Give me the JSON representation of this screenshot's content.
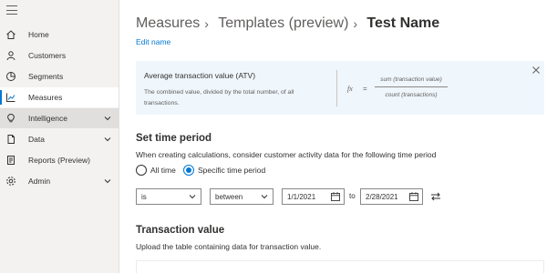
{
  "sidebar": {
    "items": [
      {
        "label": "Home",
        "icon": "home-icon"
      },
      {
        "label": "Customers",
        "icon": "people-icon"
      },
      {
        "label": "Segments",
        "icon": "pie-icon"
      },
      {
        "label": "Measures",
        "icon": "chart-icon",
        "active": true
      },
      {
        "label": "Intelligence",
        "icon": "lightbulb-icon",
        "expandable": true
      },
      {
        "label": "Data",
        "icon": "database-icon",
        "expandable": true
      },
      {
        "label": "Reports (Preview)",
        "icon": "report-icon"
      },
      {
        "label": "Admin",
        "icon": "gear-icon",
        "expandable": true
      }
    ]
  },
  "breadcrumb": {
    "part1": "Measures",
    "part2": "Templates (preview)",
    "current": "Test Name"
  },
  "edit_name": "Edit name",
  "info_card": {
    "title": "Average transaction value (ATV)",
    "description": "The combined value, divided by the total number, of all transactions.",
    "formula": {
      "fx": "fx",
      "eq": "=",
      "numerator": "sum (transaction value)",
      "denominator": "count (transactions)"
    }
  },
  "time_period": {
    "heading": "Set time period",
    "subtitle": "When creating calculations, consider customer activity data for the following time period",
    "options": [
      "All time",
      "Specific time period"
    ],
    "selected": "Specific time period",
    "operator": "is",
    "comparison": "between",
    "from_date": "1/1/2021",
    "to_label": "to",
    "to_date": "2/28/2021"
  },
  "transaction_value": {
    "heading": "Transaction value",
    "subtitle": "Upload the table containing data for transaction value."
  },
  "colors": {
    "accent": "#0078d4",
    "sidebar_bg": "#f3f2f1",
    "info_bg": "#eff6fc"
  }
}
